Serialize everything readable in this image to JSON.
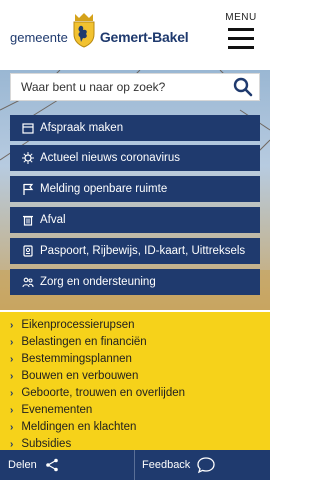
{
  "logo": {
    "prefix": "gemeente",
    "name": "Gemert-Bakel"
  },
  "menu": {
    "label": "MENU"
  },
  "search": {
    "placeholder": "Waar bent u naar op zoek?"
  },
  "tiles": [
    {
      "label": "Afspraak maken",
      "icon": "calendar-icon"
    },
    {
      "label": "Actueel nieuws coronavirus",
      "icon": "virus-icon"
    },
    {
      "label": "Melding openbare ruimte",
      "icon": "flag-icon"
    },
    {
      "label": "Afval",
      "icon": "trash-icon"
    },
    {
      "label": "Paspoort, Rijbewijs, ID-kaart, Uittreksels",
      "icon": "id-card-icon"
    },
    {
      "label": "Zorg en ondersteuning",
      "icon": "people-icon"
    }
  ],
  "topics": [
    "Eikenprocessierupsen",
    "Belastingen en financiën",
    "Bestemmingsplannen",
    "Bouwen en verbouwen",
    "Geboorte, trouwen en overlijden",
    "Evenementen",
    "Meldingen en klachten",
    "Subsidies"
  ],
  "footer": {
    "share_label": "Delen",
    "feedback_label": "Feedback"
  },
  "colors": {
    "primary": "#1f3a6e",
    "accent_yellow": "#f6d21a"
  }
}
